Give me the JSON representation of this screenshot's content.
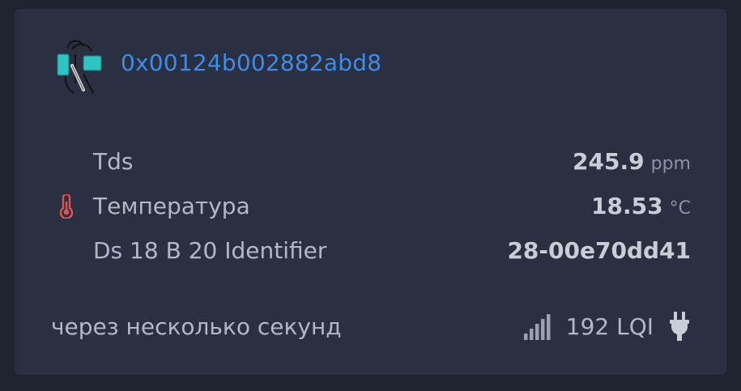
{
  "device": {
    "ieee_address": "0x00124b002882abd8",
    "image_icon": "tds-temperature-sensor-image"
  },
  "rows": [
    {
      "label": "Tds",
      "value": "245.9",
      "unit": "ppm",
      "icon": ""
    },
    {
      "label": "Температура",
      "value": "18.53",
      "unit": "°C",
      "icon": "thermometer-icon"
    },
    {
      "label": "Ds 18 B 20 Identifier",
      "value": "28-00e70dd41",
      "unit": "",
      "icon": ""
    }
  ],
  "footer": {
    "last_seen": "через несколько секунд",
    "lqi": "192 LQI",
    "signal_icon": "signal-strength-icon",
    "power_icon": "plug-icon"
  },
  "colors": {
    "background": "#1f2430",
    "card": "#2a2f41",
    "link": "#3f8ce8",
    "thermometer": "#e05252"
  }
}
